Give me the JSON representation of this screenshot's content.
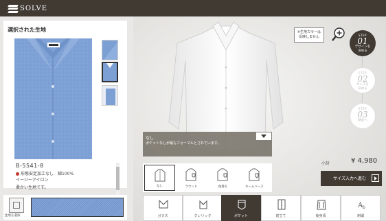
{
  "header": {
    "brand": "SOLVE"
  },
  "left_panel": {
    "title": "選択された生地",
    "fabric_code": "B-5541-8",
    "specs": [
      "形態安定加工なし　綿100%",
      "イージーアイロン",
      "柔かい生地です。"
    ]
  },
  "swatch_bar": {
    "button_label": "生地を選択"
  },
  "notice": {
    "lines": [
      "※生地カラーは",
      "反映しません"
    ]
  },
  "steps": [
    {
      "label": "STEP",
      "num": "01",
      "text": [
        "デザインを",
        "決める"
      ],
      "active": true
    },
    {
      "label": "STEP",
      "num": "02",
      "text": [
        "サイズを",
        "決める"
      ],
      "active": false
    },
    {
      "label": "STEP",
      "num": "03",
      "text": [
        "",
        "納品へ"
      ],
      "active": false
    }
  ],
  "option": {
    "title": "なし",
    "description": "ポケットなしが最もフォーマルとされています。"
  },
  "pocket_options": [
    {
      "label": "なし",
      "selected": true
    },
    {
      "label": "ラウンド",
      "selected": false
    },
    {
      "label": "角落ち",
      "selected": false
    },
    {
      "label": "ホームベース",
      "selected": false
    }
  ],
  "price": {
    "subtotal_label": "小計",
    "value": "¥ 4,980"
  },
  "next_button": {
    "label": "サイズ入力へ進む"
  },
  "tabs": [
    {
      "label": "ガラス",
      "active": false,
      "icon": "collar-icon"
    },
    {
      "label": "クレリック",
      "active": false,
      "icon": "cleric-icon"
    },
    {
      "label": "ポケット",
      "active": true,
      "icon": "pocket-icon"
    },
    {
      "label": "前立て",
      "active": false,
      "icon": "placket-icon"
    },
    {
      "label": "後身頃",
      "active": false,
      "icon": "back-body-icon"
    },
    {
      "label": "刺繍",
      "active": false,
      "icon": "embroidery-icon"
    }
  ],
  "colors": {
    "brand_dark": "#403a33",
    "fabric_blue": "#7c9fd4",
    "accent_red": "#c0392b"
  }
}
